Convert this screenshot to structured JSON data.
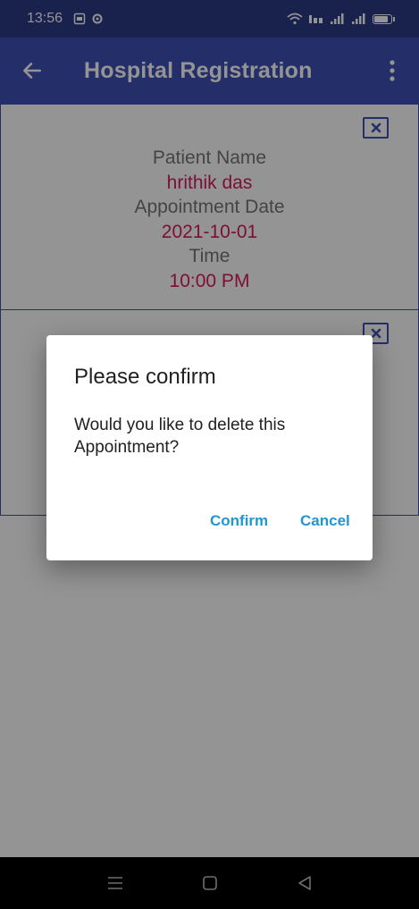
{
  "status_bar": {
    "time": "13:56",
    "battery_level": 0.9
  },
  "app_bar": {
    "title": "Hospital Registration"
  },
  "appointments": [
    {
      "patient_label": "Patient Name",
      "patient_value": "hrithik das",
      "date_label": "Appointment Date",
      "date_value": "2021-10-01",
      "time_label": "Time",
      "time_value": "10:00 PM"
    }
  ],
  "dialog": {
    "title": "Please confirm",
    "message": "Would you like to delete this Appointment?",
    "confirm_label": "Confirm",
    "cancel_label": "Cancel"
  },
  "colors": {
    "status_bar": "#2b3a86",
    "app_bar": "#3f51b5",
    "value_text": "#d81b60",
    "dialog_button": "#2196d3"
  }
}
